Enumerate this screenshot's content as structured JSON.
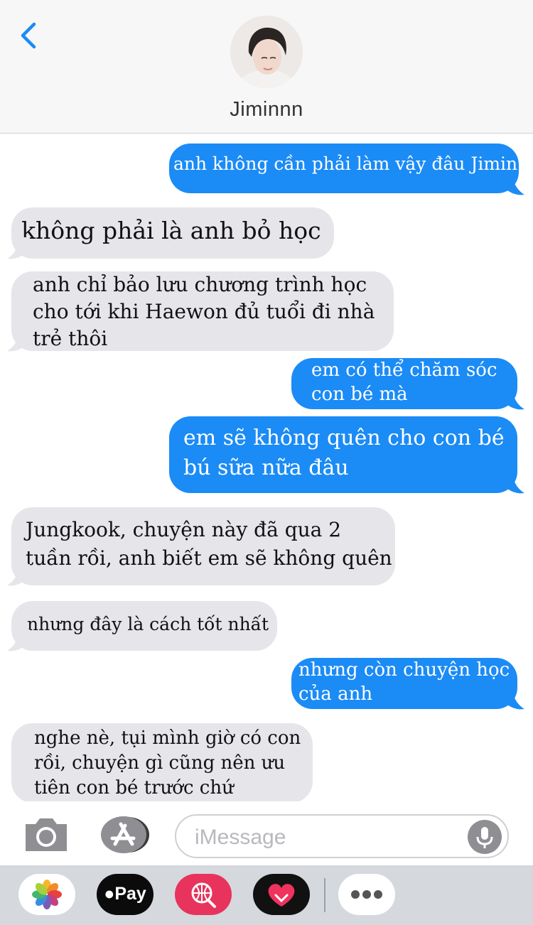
{
  "contact": {
    "name": "Jiminnn"
  },
  "messages": [
    {
      "dir": "out",
      "lines": [
        "anh không cần phải làm vậy đâu Jimin"
      ]
    },
    {
      "dir": "in",
      "lines": [
        "không phải là anh bỏ học"
      ]
    },
    {
      "dir": "in",
      "lines": [
        "anh chỉ bảo lưu chương trình học",
        "cho tới khi Haewon đủ tuổi đi nhà",
        "trẻ thôi"
      ]
    },
    {
      "dir": "out",
      "lines": [
        "em có thể chăm sóc",
        "con bé mà"
      ]
    },
    {
      "dir": "out",
      "lines": [
        "em sẽ không quên cho con bé",
        "bú sữa nữa đâu"
      ]
    },
    {
      "dir": "in",
      "lines": [
        "Jungkook, chuyện này đã qua 2",
        "tuần rồi, anh biết em sẽ không quên"
      ]
    },
    {
      "dir": "in",
      "lines": [
        "nhưng đây là cách tốt nhất"
      ]
    },
    {
      "dir": "out",
      "lines": [
        "nhưng còn chuyện học",
        "của anh"
      ]
    },
    {
      "dir": "in",
      "lines": [
        "nghe nè, tụi mình giờ có con",
        "rồi, chuyện gì cũng nên ưu",
        "tiên con bé trước chứ"
      ]
    }
  ],
  "composer": {
    "placeholder": "iMessage"
  },
  "tray": {
    "apple_pay_label": "Pay"
  },
  "colors": {
    "outgoing": "#1b8bf6",
    "incoming": "#e6e5ea",
    "accent": "#1b8bf6"
  }
}
